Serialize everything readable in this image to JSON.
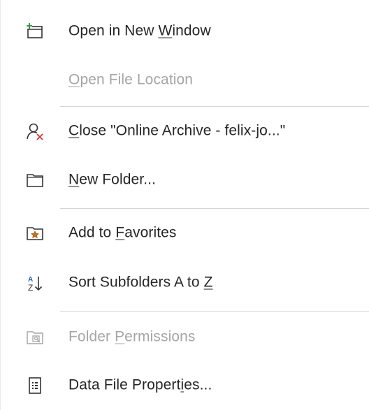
{
  "menu": {
    "items": [
      {
        "label": "Open in New Window",
        "accel_index": 12,
        "icon": "new-window-icon",
        "enabled": true
      },
      {
        "label": "Open File Location",
        "accel_index": 0,
        "icon": "",
        "enabled": false
      },
      {
        "label": "Close \"Online Archive - felix-jo...\"",
        "accel_index": 0,
        "icon": "close-person-icon",
        "enabled": true
      },
      {
        "label": "New Folder...",
        "accel_index": 0,
        "icon": "folder-icon",
        "enabled": true
      },
      {
        "label": "Add to Favorites",
        "accel_index": 7,
        "icon": "favorite-folder-icon",
        "enabled": true
      },
      {
        "label": "Sort Subfolders A to Z",
        "accel_index": 21,
        "icon": "sort-az-icon",
        "enabled": true
      },
      {
        "label": "Folder Permissions",
        "accel_index": 7,
        "icon": "folder-permissions-icon",
        "enabled": false
      },
      {
        "label": "Data File Properties...",
        "accel_index": 17,
        "icon": "data-file-properties-icon",
        "enabled": true
      }
    ]
  },
  "colors": {
    "text": "#262626",
    "disabled_text": "#a6a6a6",
    "separator": "#d4d4d4",
    "accent_green": "#2e8b3a",
    "accent_red": "#d13438",
    "accent_orange": "#c8741d"
  }
}
